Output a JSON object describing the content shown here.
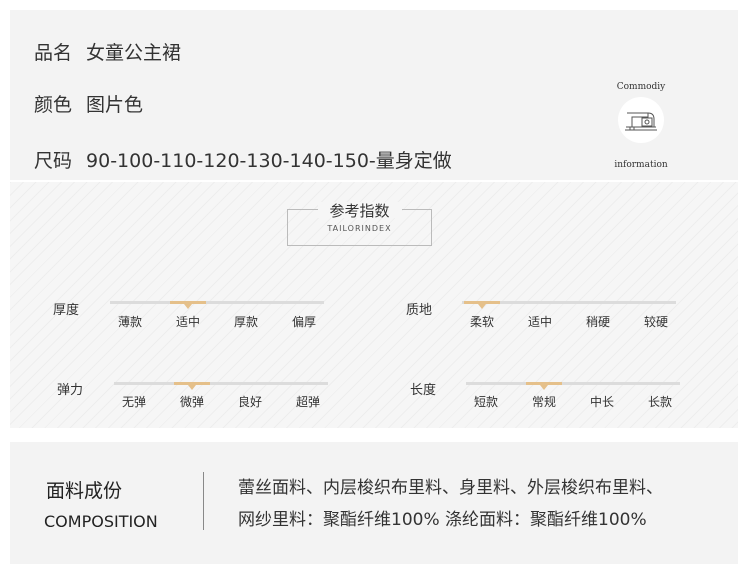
{
  "product": {
    "name_label": "品名",
    "name_value": "女童公主裙",
    "color_label": "颜色",
    "color_value": "图片色",
    "size_label": "尺码",
    "size_value": "90-100-110-120-130-140-150-量身定做"
  },
  "badge": {
    "top_text": "Commodiy",
    "bottom_text": "information",
    "icon": "sewing-machine-icon"
  },
  "reference": {
    "title": "参考指数",
    "subtitle": "TAILORINDEX",
    "scales": [
      {
        "label": "厚度",
        "options": [
          "薄款",
          "适中",
          "厚款",
          "偏厚"
        ],
        "selected_index": 1
      },
      {
        "label": "质地",
        "options": [
          "柔软",
          "适中",
          "稍硬",
          "较硬"
        ],
        "selected_index": 0
      },
      {
        "label": "弹力",
        "options": [
          "无弹",
          "微弹",
          "良好",
          "超弹"
        ],
        "selected_index": 1
      },
      {
        "label": "长度",
        "options": [
          "短款",
          "常规",
          "中长",
          "长款"
        ],
        "selected_index": 1
      }
    ]
  },
  "composition": {
    "title": "面料成份",
    "subtitle": "COMPOSITION",
    "line1": "蕾丝面料、内层梭织布里料、身里料、外层梭织布里料、",
    "line2": "网纱里料：聚酯纤维100% 涤纶面料：聚酯纤维100%"
  },
  "colors": {
    "accent": "#e5c08a",
    "panel_bg": "#f3f3f3",
    "track": "#dcdcdc"
  }
}
